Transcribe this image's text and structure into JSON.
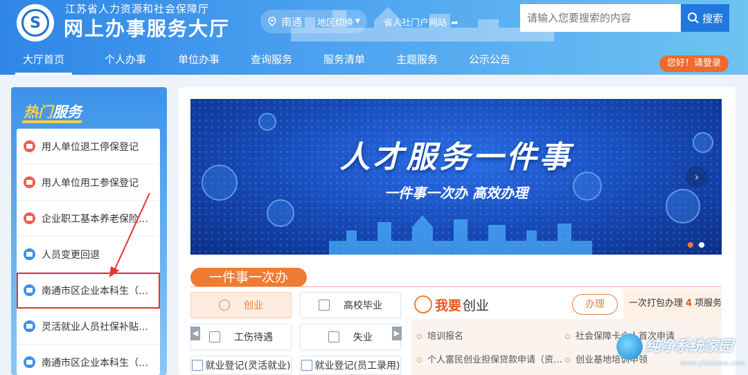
{
  "header": {
    "org_name": "江苏省人力资源和社会保障厅",
    "site_title": "网上办事服务大厅",
    "region": "南通",
    "region_switch": "地区切换",
    "portal_link": "省人社门户网站",
    "search_placeholder": "请输入您要搜索的内容",
    "search_button": "搜索",
    "login": "您好！请登录"
  },
  "nav": {
    "items": [
      "大厅首页",
      "个人办事",
      "单位办事",
      "查询服务",
      "服务清单",
      "主题服务",
      "公示公告"
    ],
    "active_index": 0
  },
  "sidebar": {
    "title_a": "热门",
    "title_b": "服务",
    "items": [
      {
        "label": "用人单位退工停保登记",
        "icon": "red"
      },
      {
        "label": "用人单位用工参保登记",
        "icon": "red"
      },
      {
        "label": "企业职工基本养老保险…",
        "icon": "red"
      },
      {
        "label": "人员变更回退",
        "icon": "blue"
      },
      {
        "label": "南通市区企业本科生（…",
        "icon": "blue"
      },
      {
        "label": "灵活就业人员社保补贴…",
        "icon": "blue"
      },
      {
        "label": "南通市区企业本科生（…",
        "icon": "blue"
      }
    ],
    "highlight_index": 4
  },
  "banner": {
    "title": "人才服务一件事",
    "subtitle": "一件事一次办  高效办理"
  },
  "section": {
    "tab_label": "一件事一次办",
    "categories": [
      {
        "label": "创业",
        "active": true
      },
      {
        "label": "高校毕业",
        "active": false
      },
      {
        "label": "工伤待遇",
        "active": false
      },
      {
        "label": "失业",
        "active": false
      },
      {
        "label": "就业登记(灵活就业)",
        "active": false
      },
      {
        "label": "就业登记(员工录用)",
        "active": false
      }
    ]
  },
  "detail": {
    "want_label": "我要",
    "category": "创业",
    "handle_button": "办理",
    "pack_prefix": "一次打包办理",
    "pack_count": "4",
    "pack_suffix": "项服务",
    "items": [
      "培训报名",
      "社会保障卡个人首次申请",
      "个人富民创业担保贷款申请（资…",
      "创业基地培训申领"
    ]
  },
  "watermark": {
    "brand": "纯净系统家园",
    "sub": "www.yidaimei.com"
  },
  "colors": {
    "accent": "#f07b32",
    "brand_blue": "#2f86e6",
    "highlight": "#e8322d"
  }
}
